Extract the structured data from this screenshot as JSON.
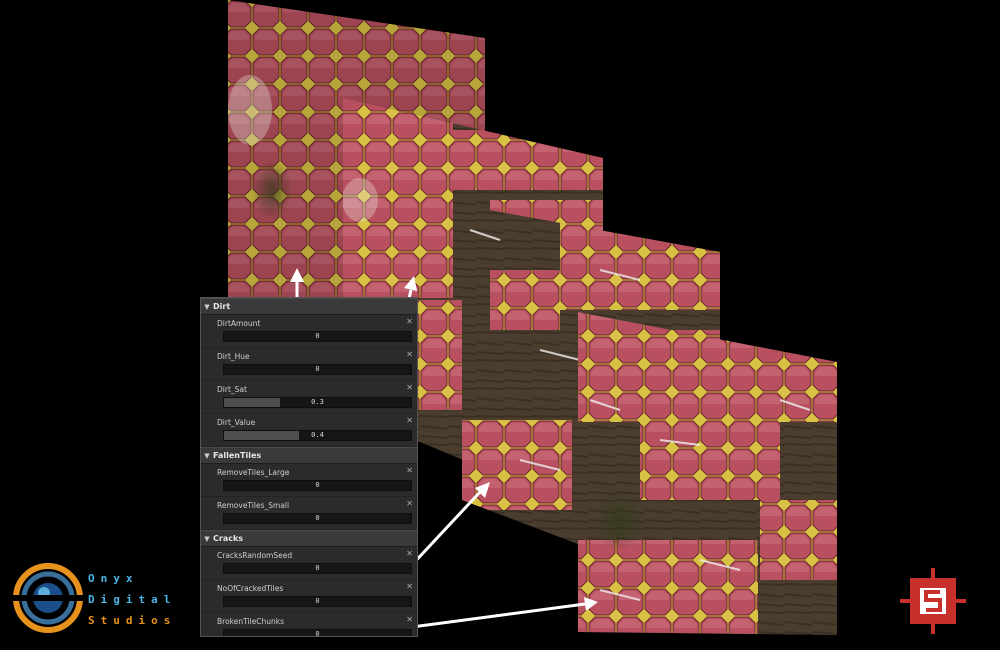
{
  "panel": {
    "sections": [
      {
        "title": "Dirt",
        "params": [
          {
            "label": "DirtAmount",
            "value": "0",
            "fill": 0
          },
          {
            "label": "Dirt_Hue",
            "value": "0",
            "fill": 0
          },
          {
            "label": "Dirt_Sat",
            "value": "0.3",
            "fill": 0.3
          },
          {
            "label": "Dirt_Value",
            "value": "0.4",
            "fill": 0.4
          }
        ]
      },
      {
        "title": "FallenTiles",
        "params": [
          {
            "label": "RemoveTiles_Large",
            "value": "0",
            "fill": 0
          },
          {
            "label": "RemoveTiles_Small",
            "value": "0",
            "fill": 0
          }
        ]
      },
      {
        "title": "Cracks",
        "params": [
          {
            "label": "CracksRandomSeed",
            "value": "0",
            "fill": 0
          },
          {
            "label": "NoOfCrackedTiles",
            "value": "0",
            "fill": 0
          },
          {
            "label": "BrokenTileChunks",
            "value": "0",
            "fill": 0
          }
        ]
      }
    ],
    "remove_glyph": "✕",
    "collapse_glyph": "▼"
  },
  "logo": {
    "lines": [
      "Onyx",
      "Digital",
      "Studios"
    ],
    "icon": "onyx-logo-icon",
    "colors": {
      "blue": "#4bb6e6",
      "orange": "#e8921e"
    }
  },
  "substance_logo": {
    "icon": "substance-logo-icon",
    "color": "#c8302b"
  },
  "colors": {
    "tile": "#b85563",
    "grout": "#d9c243",
    "ground": "#4a3d2e"
  }
}
